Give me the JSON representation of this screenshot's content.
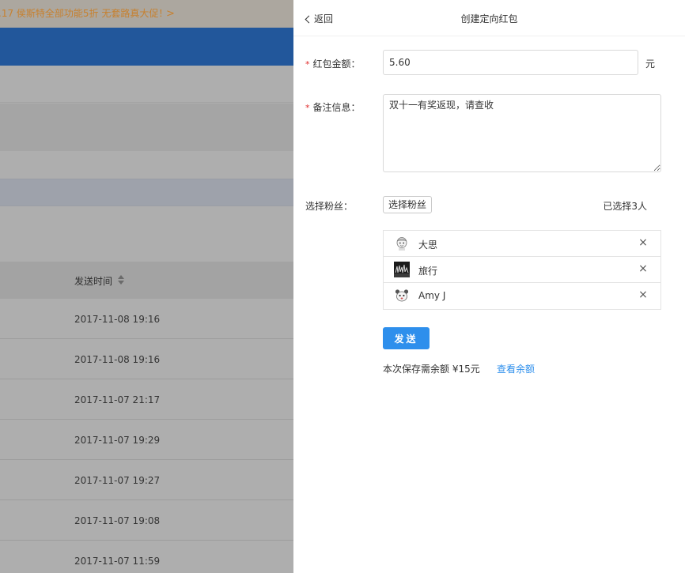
{
  "background": {
    "promo_text": ".17 侯斯特全部功能5折 无套路真大促！",
    "promo_arrow": ">",
    "table_header": "发送时间",
    "rows": [
      "2017-11-08 19:16",
      "2017-11-08 19:16",
      "2017-11-07 21:17",
      "2017-11-07 19:29",
      "2017-11-07 19:27",
      "2017-11-07 19:08",
      "2017-11-07 11:59"
    ]
  },
  "panel": {
    "back_label": "返回",
    "title": "创建定向红包",
    "amount": {
      "label": "红包金额：",
      "value": "5.60",
      "unit": "元"
    },
    "note": {
      "label": "备注信息：",
      "value": "双十一有奖返现，请查收"
    },
    "fans": {
      "label": "选择粉丝：",
      "button": "选择粉丝",
      "count_text": "已选择3人",
      "items": [
        {
          "name": "大思",
          "avatar": "cartoon-face"
        },
        {
          "name": "旅行",
          "avatar": "dark-photo"
        },
        {
          "name": "Amy J",
          "avatar": "bear-face"
        }
      ],
      "remove_glyph": "×"
    },
    "send_button": "发送",
    "balance_text": "本次保存需余额 ¥15元",
    "balance_link": "查看余额",
    "required_mark": "*"
  },
  "colors": {
    "accent": "#2e8fec",
    "required": "#e02b2b",
    "overlay": "#aeaeae",
    "blue_bar": "#22579b",
    "promo_text": "#c7802e"
  }
}
